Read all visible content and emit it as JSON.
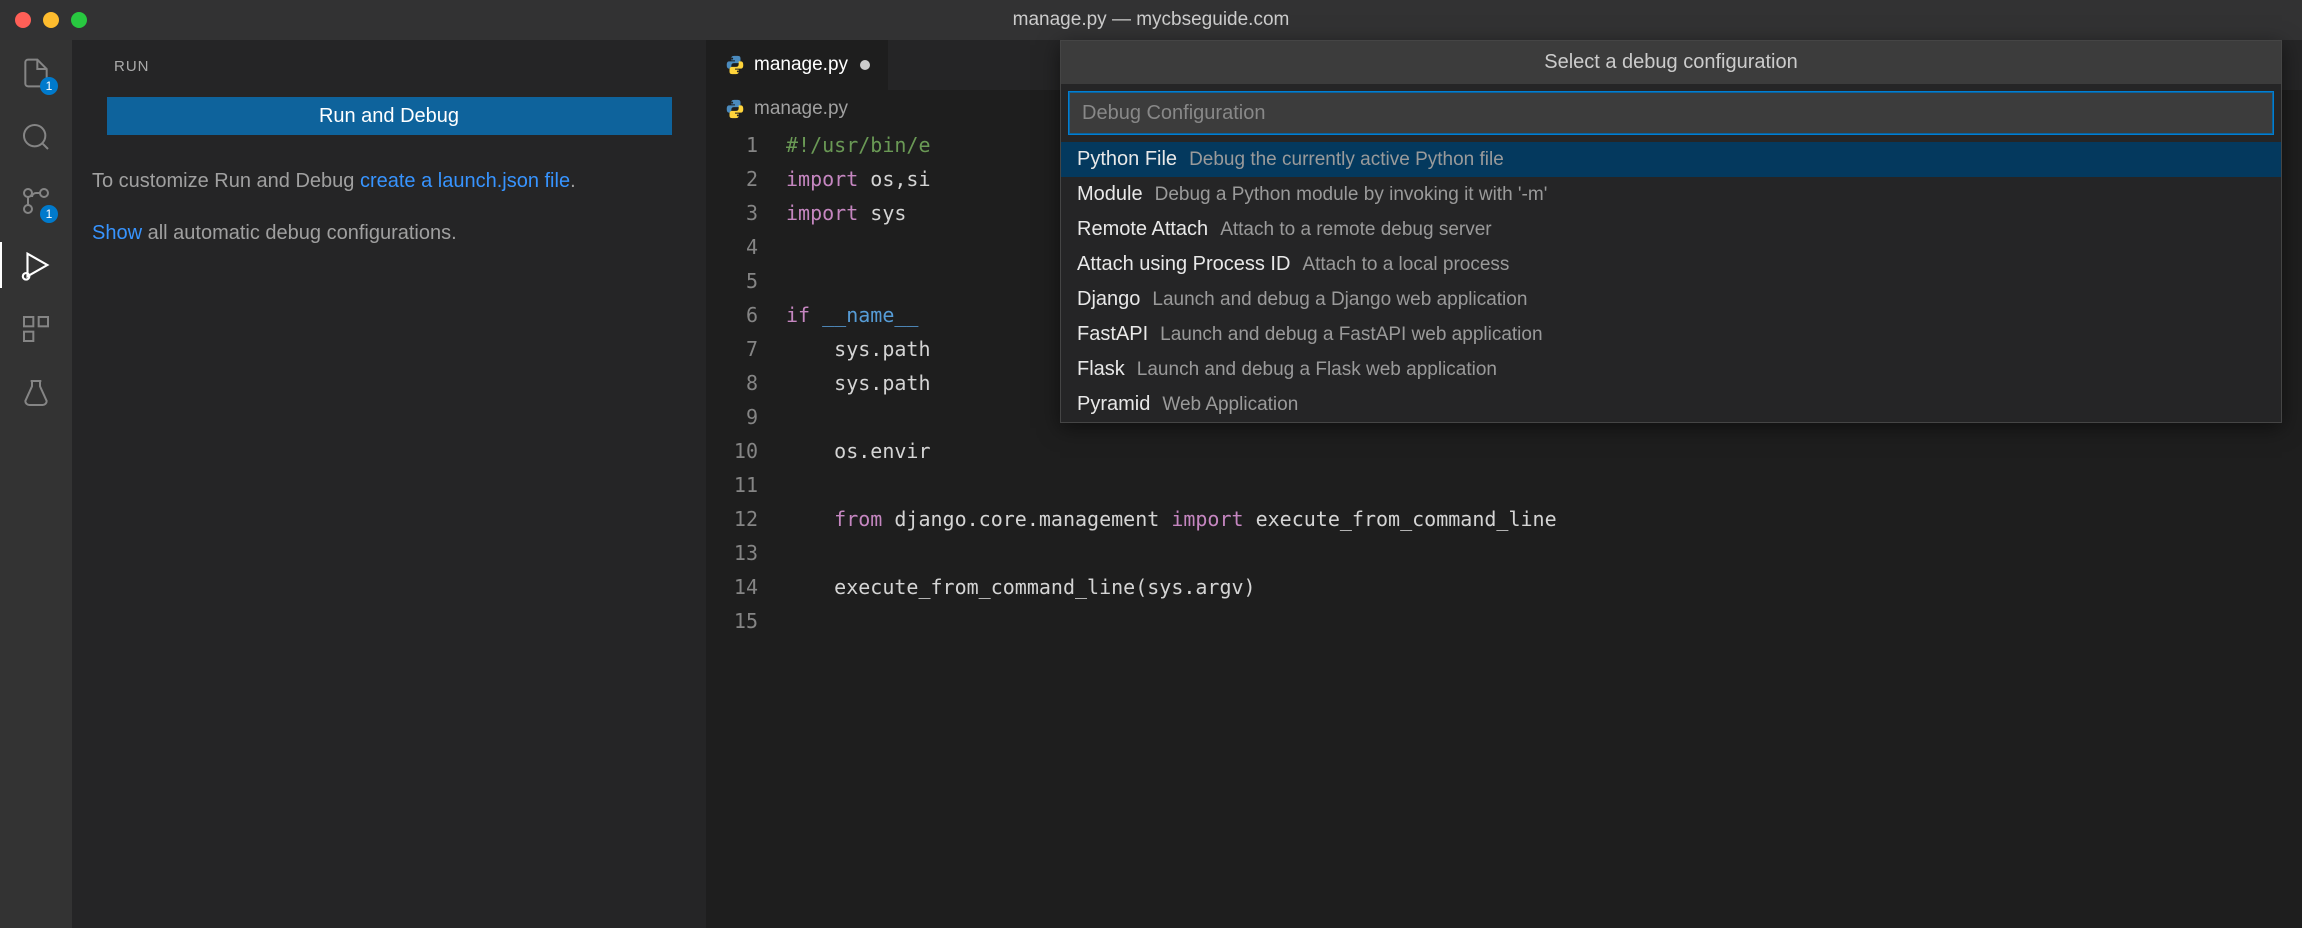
{
  "window": {
    "title": "manage.py — mycbseguide.com"
  },
  "activity": {
    "files_badge": "1",
    "scm_badge": "1"
  },
  "sidebar": {
    "title": "RUN",
    "run_debug_button": "Run and Debug",
    "customize_prefix": "To customize Run and Debug ",
    "customize_link": "create a launch.json file",
    "customize_suffix": ".",
    "show_link": "Show",
    "show_suffix": " all automatic debug configurations."
  },
  "tabs": {
    "active": "manage.py"
  },
  "breadcrumb": {
    "file": "manage.py"
  },
  "code": {
    "lines": [
      "1",
      "2",
      "3",
      "4",
      "5",
      "6",
      "7",
      "8",
      "9",
      "10",
      "11",
      "12",
      "13",
      "14",
      "15"
    ],
    "l1": "#!/usr/bin/e",
    "l2_kw": "import",
    "l2_rest": " os,si",
    "l3_kw": "import",
    "l3_rest": " sys",
    "l6_kw": "if",
    "l6_var": " __name__ ",
    "l7": "    sys.path",
    "l8": "    sys.path",
    "l10": "    os.envir",
    "l12_kw1": "    from",
    "l12_mod": " django.core.management ",
    "l12_kw2": "import",
    "l12_rest": " execute_from_command_line",
    "l14": "    execute_from_command_line(sys.argv)"
  },
  "quickpick": {
    "title": "Select a debug configuration",
    "placeholder": "Debug Configuration",
    "items": [
      {
        "label": "Python File",
        "desc": "Debug the currently active Python file"
      },
      {
        "label": "Module",
        "desc": "Debug a Python module by invoking it with '-m'"
      },
      {
        "label": "Remote Attach",
        "desc": "Attach to a remote debug server"
      },
      {
        "label": "Attach using Process ID",
        "desc": "Attach to a local process"
      },
      {
        "label": "Django",
        "desc": "Launch and debug a Django web application"
      },
      {
        "label": "FastAPI",
        "desc": "Launch and debug a FastAPI web application"
      },
      {
        "label": "Flask",
        "desc": "Launch and debug a Flask web application"
      },
      {
        "label": "Pyramid",
        "desc": "Web Application"
      }
    ]
  }
}
